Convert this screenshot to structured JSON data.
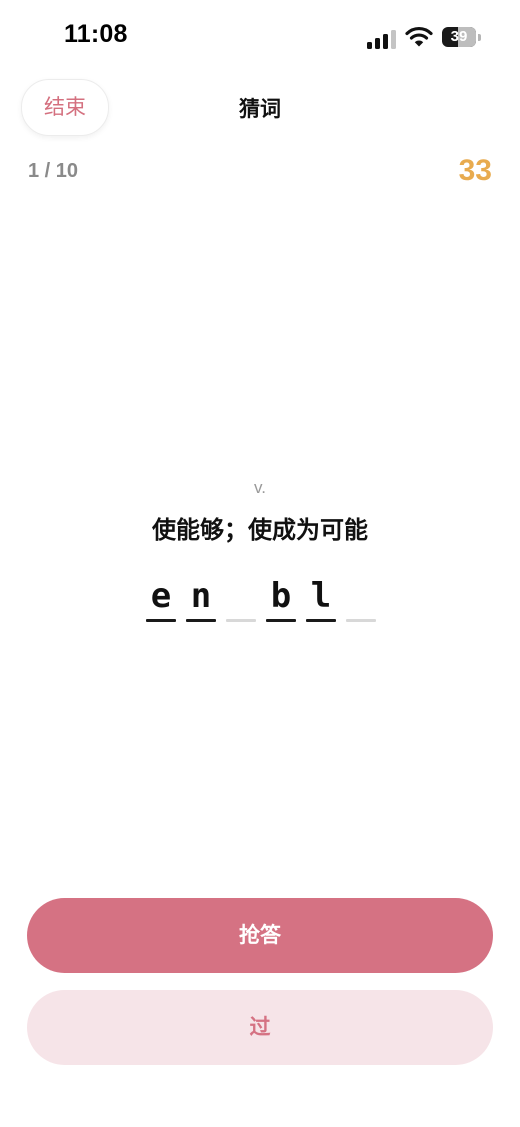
{
  "status_bar": {
    "time": "11:08",
    "battery_level": "39",
    "icons": [
      "cellular-signal-icon",
      "wifi-icon",
      "battery-icon"
    ]
  },
  "nav": {
    "end_label": "结束",
    "title": "猜词"
  },
  "progress": {
    "text": "1 / 10"
  },
  "timer": {
    "value": "33"
  },
  "word": {
    "part_of_speech": "v.",
    "meaning": "使能够；使成为可能",
    "slots": [
      "e",
      "n",
      "",
      "b",
      "l",
      ""
    ]
  },
  "actions": {
    "answer_label": "抢答",
    "pass_label": "过"
  },
  "colors": {
    "accent": "#d57283",
    "accent_light": "#f6e4e8",
    "timer": "#e8ab4f"
  }
}
